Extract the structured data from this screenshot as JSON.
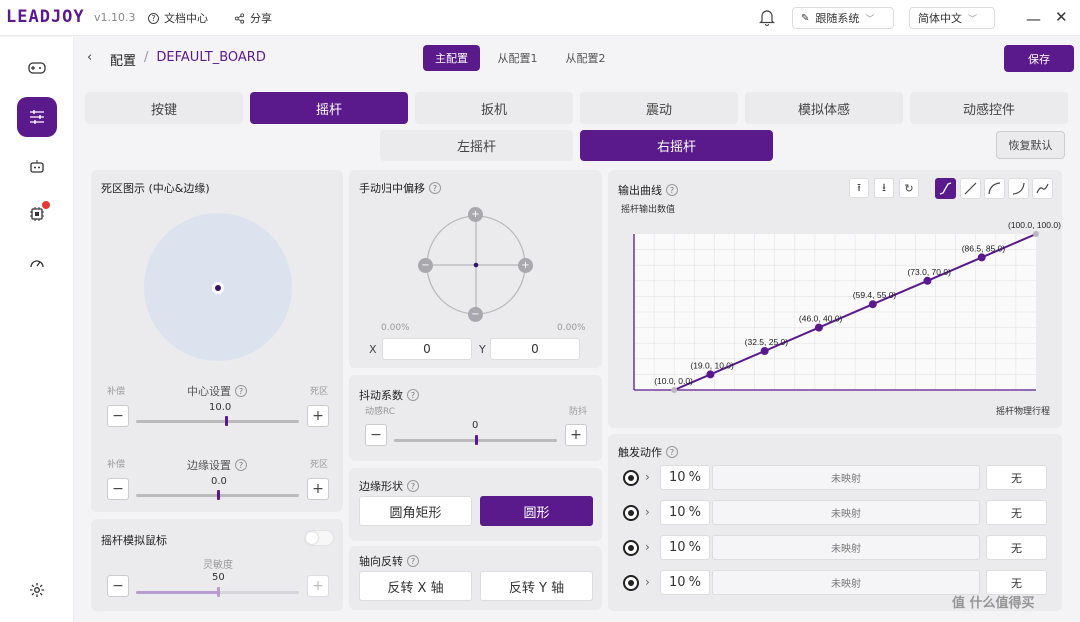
{
  "app": {
    "logo": "LEADJOY",
    "version": "v1.10.3",
    "docs": "文档中心",
    "share": "分享",
    "theme_select": "跟随系统",
    "lang_select": "简体中文"
  },
  "crumb": {
    "root": "配置",
    "sep": "/",
    "board": "DEFAULT_BOARD"
  },
  "profiles": [
    "主配置",
    "从配置1",
    "从配置2"
  ],
  "save": "保存",
  "tabs": [
    "按键",
    "摇杆",
    "扳机",
    "震动",
    "模拟体感",
    "动感控件"
  ],
  "subtabs": [
    "左摇杆",
    "右摇杆"
  ],
  "restore": "恢复默认",
  "deadzone": {
    "title": "死区图示 (中心&边缘)",
    "center_left": "补偿",
    "center_label": "中心设置",
    "center_right": "死区",
    "center_value": "10.0",
    "center_frac": 0.55,
    "edge_left": "补偿",
    "edge_label": "边缘设置",
    "edge_right": "死区",
    "edge_value": "0.0",
    "edge_frac": 0.5
  },
  "mouse": {
    "title": "摇杆模拟鼠标",
    "sens_label": "灵敏度",
    "sens_value": "50",
    "sens_frac": 0.5
  },
  "offset": {
    "title": "手动归中偏移",
    "left_pct": "0.00%",
    "right_pct": "0.00%",
    "x_label": "X",
    "x_value": "0",
    "y_label": "Y",
    "y_value": "0"
  },
  "jitter": {
    "title": "抖动系数",
    "left": "动感RC",
    "right": "防抖",
    "value": "0",
    "frac": 0.5
  },
  "edge_shape": {
    "title": "边缘形状",
    "options": [
      "圆角矩形",
      "圆形"
    ],
    "selected": 1
  },
  "axis_invert": {
    "title": "轴向反转",
    "x": "反转 X 轴",
    "y": "反转 Y 轴"
  },
  "curve": {
    "title": "输出曲线",
    "ylabel": "摇杆输出数值",
    "xlabel": "摇杆物理行程"
  },
  "chart_data": {
    "type": "line",
    "points": [
      [
        10.0,
        0.0
      ],
      [
        19.0,
        10.0
      ],
      [
        32.5,
        25.0
      ],
      [
        46.0,
        40.0
      ],
      [
        59.4,
        55.0
      ],
      [
        73.0,
        70.0
      ],
      [
        86.5,
        85.0
      ],
      [
        100.0,
        100.0
      ]
    ],
    "labels": [
      "(10.0, 0.0)",
      "(19.0, 10.0)",
      "(32.5, 25.0)",
      "(46.0, 40.0)",
      "(59.4, 55.0)",
      "(73.0, 70.0)",
      "(86.5, 85.0)",
      "(100.0, 100.0)"
    ],
    "xlim": [
      0,
      100
    ],
    "ylim": [
      0,
      100
    ],
    "grid": true,
    "color": "#5b1a8c"
  },
  "trigger": {
    "title": "触发动作",
    "rows": [
      {
        "value": "10",
        "unit": "%",
        "mapping": "未映射",
        "action": "无"
      },
      {
        "value": "10",
        "unit": "%",
        "mapping": "未映射",
        "action": "无"
      },
      {
        "value": "10",
        "unit": "%",
        "mapping": "未映射",
        "action": "无"
      },
      {
        "value": "10",
        "unit": "%",
        "mapping": "未映射",
        "action": "无"
      }
    ]
  },
  "watermark": "值 什么值得买",
  "colors": {
    "accent": "#5b1a8c",
    "badge": "#e53935"
  }
}
